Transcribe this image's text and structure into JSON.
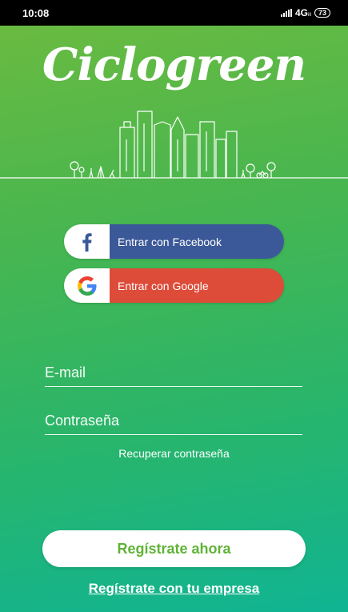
{
  "status_bar": {
    "time": "10:08",
    "network": "4G",
    "network_sub": "ill",
    "battery": "73"
  },
  "app": {
    "logo_text": "Ciclogreen"
  },
  "social": {
    "facebook_label": "Entrar con Facebook",
    "google_label": "Entrar con Google"
  },
  "form": {
    "email_placeholder": "E-mail",
    "password_placeholder": "Contraseña",
    "forgot_password": "Recuperar contraseña"
  },
  "actions": {
    "register_label": "Regístrate ahora",
    "company_register_label": "Regístrate con tu empresa"
  },
  "colors": {
    "facebook": "#3b5998",
    "google": "#dd4b39",
    "brand_green": "#5fb336",
    "gradient_top": "#6dbb3f",
    "gradient_bottom": "#10b493"
  },
  "icons": [
    "facebook-icon",
    "google-icon",
    "signal-icon",
    "battery-icon",
    "skyline-illustration"
  ]
}
